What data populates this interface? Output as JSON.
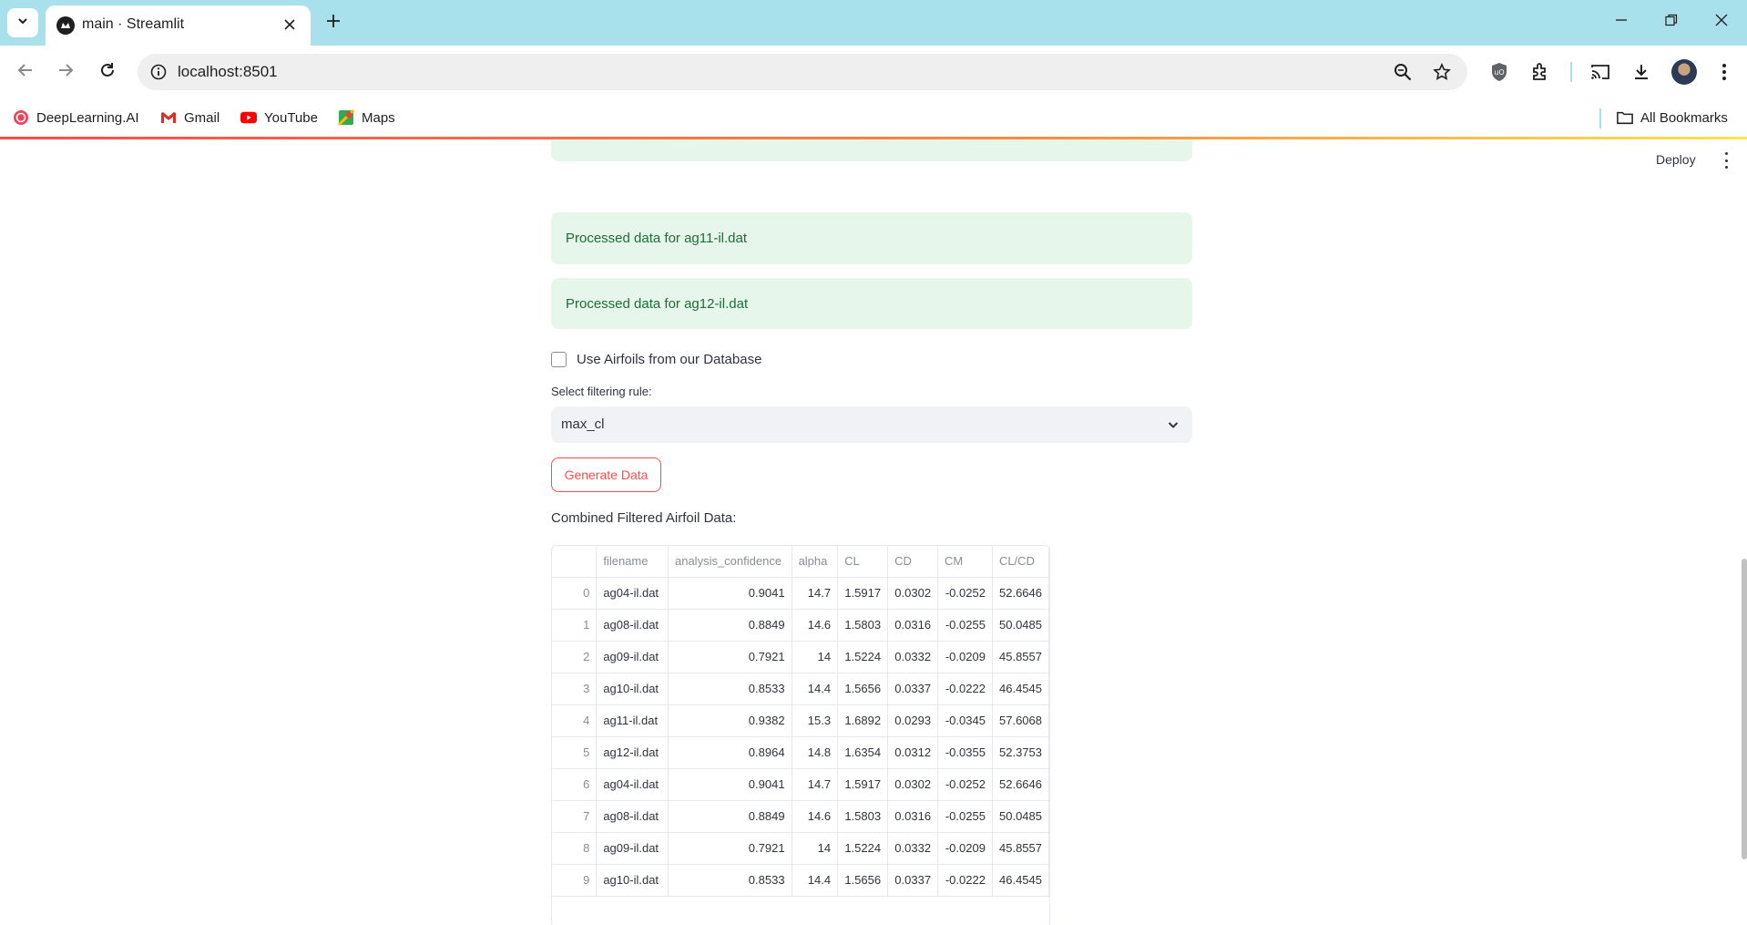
{
  "browser": {
    "tab_title": "main · Streamlit",
    "url": "localhost:8501",
    "bookmarks": [
      {
        "label": "DeepLearning.AI",
        "icon": "deeplearning-icon"
      },
      {
        "label": "Gmail",
        "icon": "gmail-icon"
      },
      {
        "label": "YouTube",
        "icon": "youtube-icon"
      },
      {
        "label": "Maps",
        "icon": "maps-icon"
      }
    ],
    "all_bookmarks": "All Bookmarks"
  },
  "app": {
    "deploy_label": "Deploy",
    "alerts": [
      "",
      "Processed data for ag11-il.dat",
      "Processed data for ag12-il.dat"
    ],
    "checkbox_label": "Use Airfoils from our Database",
    "select_label": "Select filtering rule:",
    "select_value": "max_cl",
    "button_label": "Generate Data",
    "dataframe_title": "Combined Filtered Airfoil Data:",
    "table": {
      "columns": [
        "",
        "filename",
        "analysis_confidence",
        "alpha",
        "CL",
        "CD",
        "CM",
        "CL/CD"
      ],
      "rows": [
        [
          "0",
          "ag04-il.dat",
          "0.9041",
          "14.7",
          "1.5917",
          "0.0302",
          "-0.0252",
          "52.6646"
        ],
        [
          "1",
          "ag08-il.dat",
          "0.8849",
          "14.6",
          "1.5803",
          "0.0316",
          "-0.0255",
          "50.0485"
        ],
        [
          "2",
          "ag09-il.dat",
          "0.7921",
          "14",
          "1.5224",
          "0.0332",
          "-0.0209",
          "45.8557"
        ],
        [
          "3",
          "ag10-il.dat",
          "0.8533",
          "14.4",
          "1.5656",
          "0.0337",
          "-0.0222",
          "46.4545"
        ],
        [
          "4",
          "ag11-il.dat",
          "0.9382",
          "15.3",
          "1.6892",
          "0.0293",
          "-0.0345",
          "57.6068"
        ],
        [
          "5",
          "ag12-il.dat",
          "0.8964",
          "14.8",
          "1.6354",
          "0.0312",
          "-0.0355",
          "52.3753"
        ],
        [
          "6",
          "ag04-il.dat",
          "0.9041",
          "14.7",
          "1.5917",
          "0.0302",
          "-0.0252",
          "52.6646"
        ],
        [
          "7",
          "ag08-il.dat",
          "0.8849",
          "14.6",
          "1.5803",
          "0.0316",
          "-0.0255",
          "50.0485"
        ],
        [
          "8",
          "ag09-il.dat",
          "0.7921",
          "14",
          "1.5224",
          "0.0332",
          "-0.0209",
          "45.8557"
        ],
        [
          "9",
          "ag10-il.dat",
          "0.8533",
          "14.4",
          "1.5656",
          "0.0337",
          "-0.0222",
          "46.4545"
        ]
      ]
    }
  }
}
